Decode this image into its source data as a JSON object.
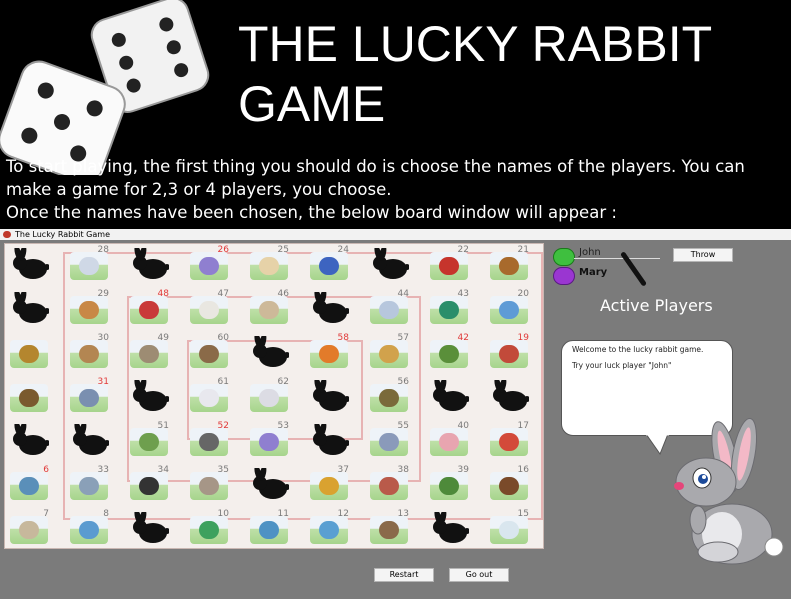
{
  "banner": {
    "title": "THE LUCKY RABBIT GAME",
    "intro_line1": "To start playing, the first thing you should do is choose the names of the players. You can make a game for 2,3 or 4 players, you choose.",
    "intro_line2": "Once the names have been chosen, the below board window will appear :"
  },
  "window": {
    "title": "The Lucky Rabbit Game"
  },
  "board": {
    "cells": [
      {
        "n": "",
        "kind": "rabbit"
      },
      {
        "n": "28",
        "kind": "elephant",
        "color": "#cfd8e6"
      },
      {
        "n": "",
        "kind": "rabbit"
      },
      {
        "n": "26",
        "kind": "gift",
        "color": "#8f7fd0",
        "red": true
      },
      {
        "n": "25",
        "kind": "deer",
        "color": "#e6d2a8"
      },
      {
        "n": "24",
        "kind": "fish",
        "color": "#3d64c0"
      },
      {
        "n": "",
        "kind": "rabbit"
      },
      {
        "n": "22",
        "kind": "peacock",
        "color": "#c6342c"
      },
      {
        "n": "21",
        "kind": "owl",
        "color": "#a86a2c"
      },
      {
        "n": "",
        "kind": "rabbit"
      },
      {
        "n": "29",
        "kind": "antelope",
        "color": "#c88846"
      },
      {
        "n": "48",
        "kind": "berry",
        "color": "#c93a3a",
        "red": true
      },
      {
        "n": "47",
        "kind": "sheep",
        "color": "#e9e7e1"
      },
      {
        "n": "46",
        "kind": "goat",
        "color": "#cdb999"
      },
      {
        "n": "",
        "kind": "rabbit"
      },
      {
        "n": "44",
        "kind": "dolphin",
        "color": "#b7c7dd"
      },
      {
        "n": "43",
        "kind": "peacock",
        "color": "#2a8e6a"
      },
      {
        "n": "20",
        "kind": "bird",
        "color": "#5e9bd6"
      },
      {
        "n": "",
        "kind": "lion",
        "color": "#b4862e"
      },
      {
        "n": "30",
        "kind": "deer",
        "color": "#b38652"
      },
      {
        "n": "49",
        "kind": "raccoon",
        "color": "#9d8c73"
      },
      {
        "n": "60",
        "kind": "bird",
        "color": "#8a6a48"
      },
      {
        "n": "",
        "kind": "rabbit"
      },
      {
        "n": "58",
        "kind": "cart",
        "color": "#e27b2a",
        "red": true
      },
      {
        "n": "57",
        "kind": "kangaroo",
        "color": "#d1a24c"
      },
      {
        "n": "42",
        "kind": "maze",
        "color": "#5a8f3a",
        "red": true
      },
      {
        "n": "19",
        "kind": "house",
        "color": "#c24a3a",
        "red": true
      },
      {
        "n": "",
        "kind": "beaver",
        "color": "#7a5a2e"
      },
      {
        "n": "31",
        "kind": "well",
        "color": "#7a8fb0",
        "red": true
      },
      {
        "n": "",
        "kind": "rabbit"
      },
      {
        "n": "61",
        "kind": "rabbit-white",
        "color": "#e8e8ee"
      },
      {
        "n": "62",
        "kind": "rabbit-white",
        "color": "#dcdce4"
      },
      {
        "n": "",
        "kind": "rabbit"
      },
      {
        "n": "56",
        "kind": "bird",
        "color": "#7a6a3a"
      },
      {
        "n": "",
        "kind": "rabbit"
      },
      {
        "n": "",
        "kind": "rabbit"
      },
      {
        "n": "",
        "kind": "rabbit"
      },
      {
        "n": "",
        "kind": "rabbit"
      },
      {
        "n": "51",
        "kind": "plant",
        "color": "#6e9f4e"
      },
      {
        "n": "52",
        "kind": "prisoner",
        "color": "#666",
        "red": true
      },
      {
        "n": "53",
        "kind": "gift",
        "color": "#8f7fd0"
      },
      {
        "n": "",
        "kind": "rabbit"
      },
      {
        "n": "55",
        "kind": "donkey",
        "color": "#8a9aba"
      },
      {
        "n": "40",
        "kind": "pig",
        "color": "#e8a5b0"
      },
      {
        "n": "17",
        "kind": "chick",
        "color": "#d34a3a"
      },
      {
        "n": "6",
        "kind": "fishing",
        "color": "#5a8fb9",
        "red": true
      },
      {
        "n": "33",
        "kind": "dragonfly",
        "color": "#8aa0b8"
      },
      {
        "n": "34",
        "kind": "penguin",
        "color": "#333"
      },
      {
        "n": "35",
        "kind": "hippo",
        "color": "#a69687"
      },
      {
        "n": "",
        "kind": "rabbit"
      },
      {
        "n": "37",
        "kind": "lion",
        "color": "#d9a230"
      },
      {
        "n": "38",
        "kind": "cow",
        "color": "#b95a4a"
      },
      {
        "n": "39",
        "kind": "frog",
        "color": "#4e8a3a"
      },
      {
        "n": "16",
        "kind": "moose",
        "color": "#7a4a2a"
      },
      {
        "n": "7",
        "kind": "horse",
        "color": "#c7b89c"
      },
      {
        "n": "8",
        "kind": "rooster",
        "color": "#5b9bd0"
      },
      {
        "n": "",
        "kind": "rabbit"
      },
      {
        "n": "10",
        "kind": "frog",
        "color": "#3ea15e"
      },
      {
        "n": "11",
        "kind": "seahorse",
        "color": "#4e92c4"
      },
      {
        "n": "12",
        "kind": "bridge",
        "color": "#5a9fd2"
      },
      {
        "n": "13",
        "kind": "eagle",
        "color": "#8a6a4a"
      },
      {
        "n": "",
        "kind": "rabbit"
      },
      {
        "n": "15",
        "kind": "polar-bear",
        "color": "#d9e6ee"
      }
    ]
  },
  "panel": {
    "players": [
      {
        "name": "John",
        "color": "#3fbf3f"
      },
      {
        "name": "Mary",
        "color": "#9a36d1"
      }
    ],
    "throw_label": "Throw",
    "active_label": "Active Players",
    "messages": [
      "Welcome to the lucky rabbit game.",
      "Try your luck player \"John\""
    ],
    "restart_label": "Restart",
    "goout_label": "Go out"
  },
  "colors": {
    "window_bg": "#7b7b7b",
    "board_bg": "#f4efec",
    "ring": "#e7b3b3"
  }
}
